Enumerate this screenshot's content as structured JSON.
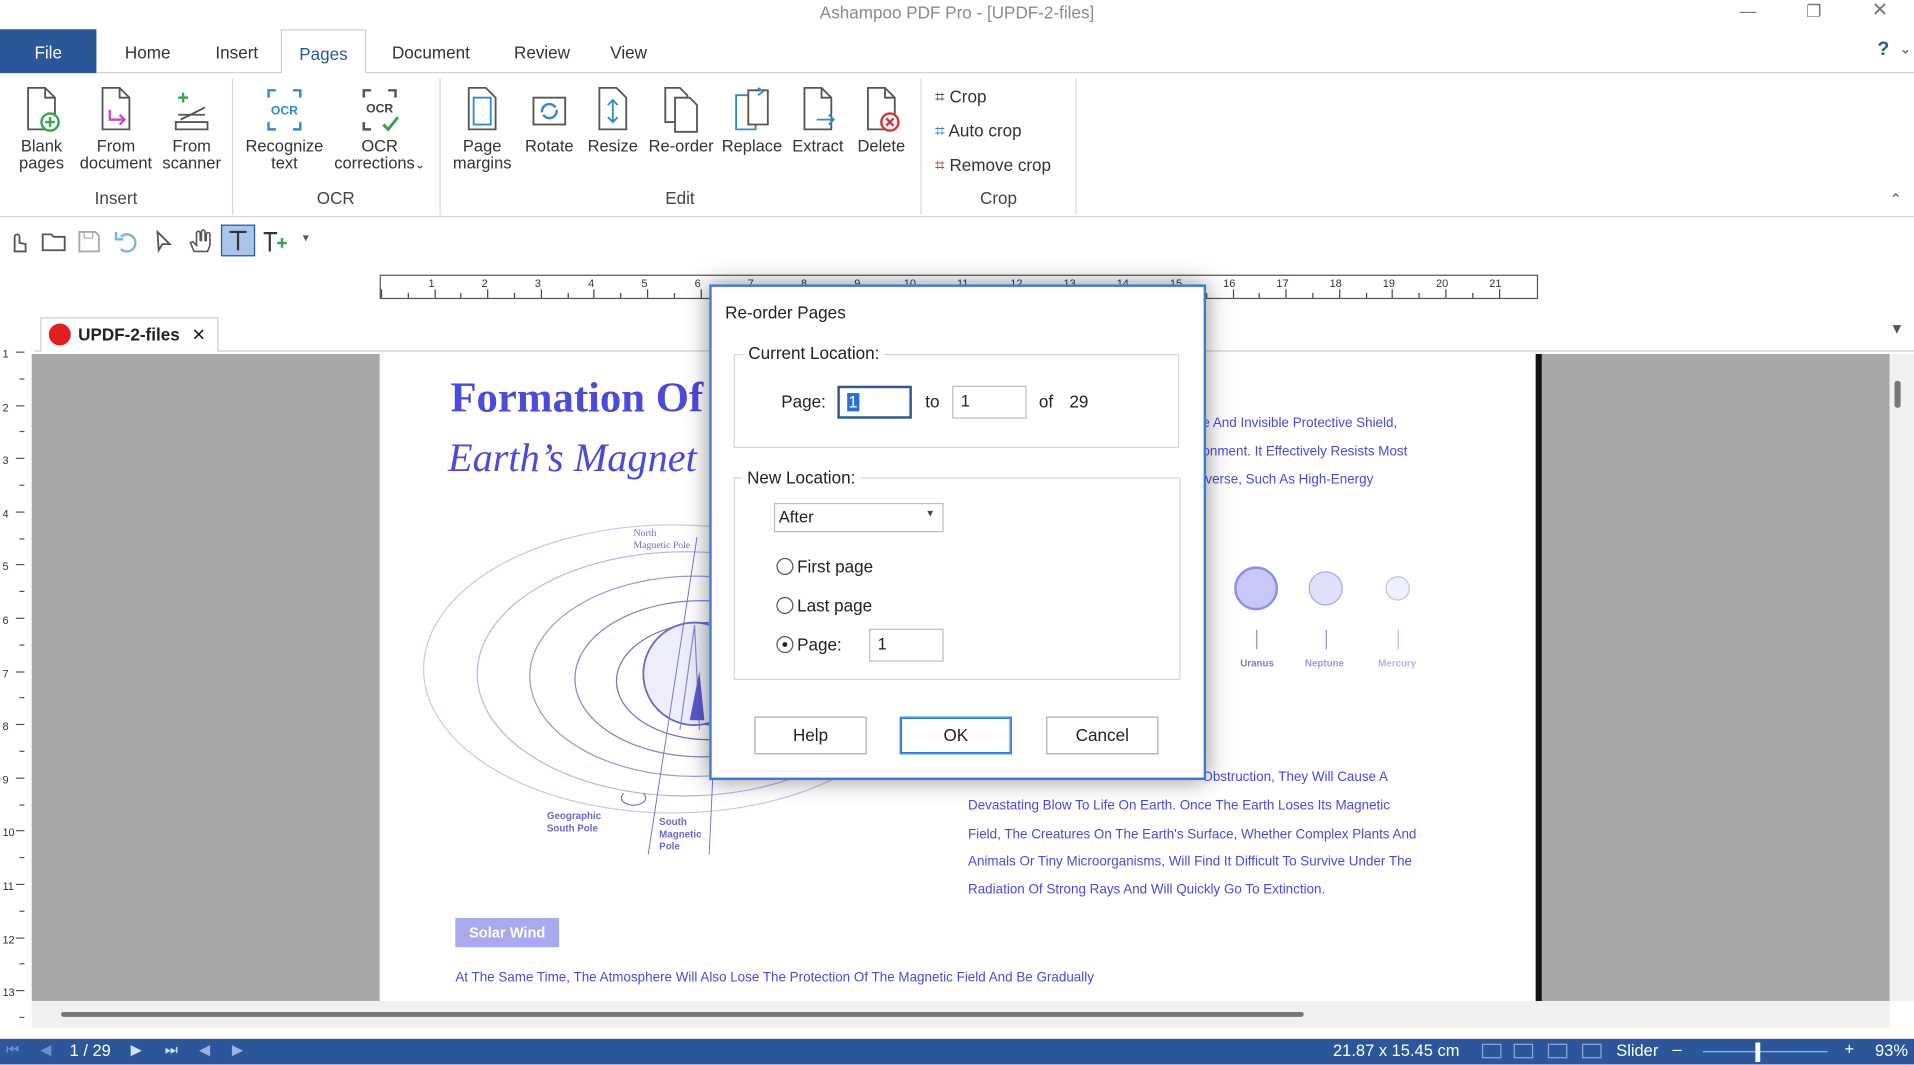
{
  "window": {
    "title": "Ashampoo PDF Pro - [UPDF-2-files]"
  },
  "tabs": [
    "File",
    "Home",
    "Insert",
    "Pages",
    "Document",
    "Review",
    "View"
  ],
  "active_tab": "Pages",
  "ribbon": {
    "insert": {
      "label": "Insert",
      "blank_l1": "Blank",
      "blank_l2": "pages",
      "doc_l1": "From",
      "doc_l2": "document",
      "scan_l1": "From",
      "scan_l2": "scanner"
    },
    "ocr": {
      "label": "OCR",
      "rec_l1": "Recognize",
      "rec_l2": "text",
      "corr_l1": "OCR",
      "corr_l2": "corrections"
    },
    "edit": {
      "label": "Edit",
      "margins_l1": "Page",
      "margins_l2": "margins",
      "rotate": "Rotate",
      "resize": "Resize",
      "reorder": "Re-order",
      "replace": "Replace",
      "extract": "Extract",
      "delete": "Delete"
    },
    "crop": {
      "label": "Crop",
      "crop": "Crop",
      "auto": "Auto crop",
      "remove": "Remove crop"
    }
  },
  "help_mark": "?",
  "ruler_numbers": [
    "1",
    "2",
    "3",
    "4",
    "5",
    "6",
    "7",
    "8",
    "9",
    "10",
    "11",
    "12",
    "13",
    "14",
    "15",
    "16",
    "17",
    "18",
    "19",
    "20",
    "21"
  ],
  "vruler_numbers": [
    "1",
    "2",
    "3",
    "4",
    "5",
    "6",
    "7",
    "8",
    "9",
    "10",
    "11",
    "12",
    "13"
  ],
  "document_tab": {
    "name": "UPDF-2-files",
    "close": "✕"
  },
  "document": {
    "heading1": "Formation Of",
    "heading2": "Earth’s Magnet",
    "right_lines_top": [
      "e And Invisible Protective Shield,",
      "onment. It Effectively Resists Most",
      "iverse, Such As High-Energy"
    ],
    "planets": [
      "Uranus",
      "Neptune",
      "Mercury"
    ],
    "diagram_labels": {
      "north_l1": "North",
      "north_l2": "Magnetic Pole",
      "geo_l1": "Geographic",
      "geo_l2": "South Pole",
      "south_l1": "South",
      "south_l2": "Magnetic",
      "south_l3": "Pole"
    },
    "right_lines_bottom": [
      "Obstruction, They Will Cause A",
      "Devastating Blow To Life On Earth. Once The Earth Loses Its Magnetic",
      "Field, The Creatures On The Earth's Surface, Whether Complex Plants And",
      "Animals Or Tiny Microorganisms, Will Find It Difficult To Survive Under The",
      "Radiation Of Strong Rays And Will Quickly Go To Extinction."
    ],
    "solar_wind": "Solar Wind",
    "bottom_line": "At The Same Time, The Atmosphere Will Also Lose The Protection Of The Magnetic Field And Be Gradually"
  },
  "dialog": {
    "title": "Re-order Pages",
    "current_location": "Current Location:",
    "page_label": "Page:",
    "from_value": "1",
    "to_label": "to",
    "to_value": "1",
    "of_label": "of",
    "total": "29",
    "new_location": "New Location:",
    "position_select": "After",
    "first_page": "First page",
    "last_page": "Last page",
    "page_option": "Page:",
    "target_page": "1",
    "help": "Help",
    "ok": "OK",
    "cancel": "Cancel"
  },
  "status": {
    "page": "1 / 29",
    "dimensions": "21.87 x 15.45 cm",
    "mode": "Slider",
    "zoom": "93%",
    "minus": "–",
    "plus": "+"
  },
  "colors": {
    "accent": "#2b579a",
    "doc_text": "#4a4adb",
    "dialog_border": "#3a7bd5"
  }
}
